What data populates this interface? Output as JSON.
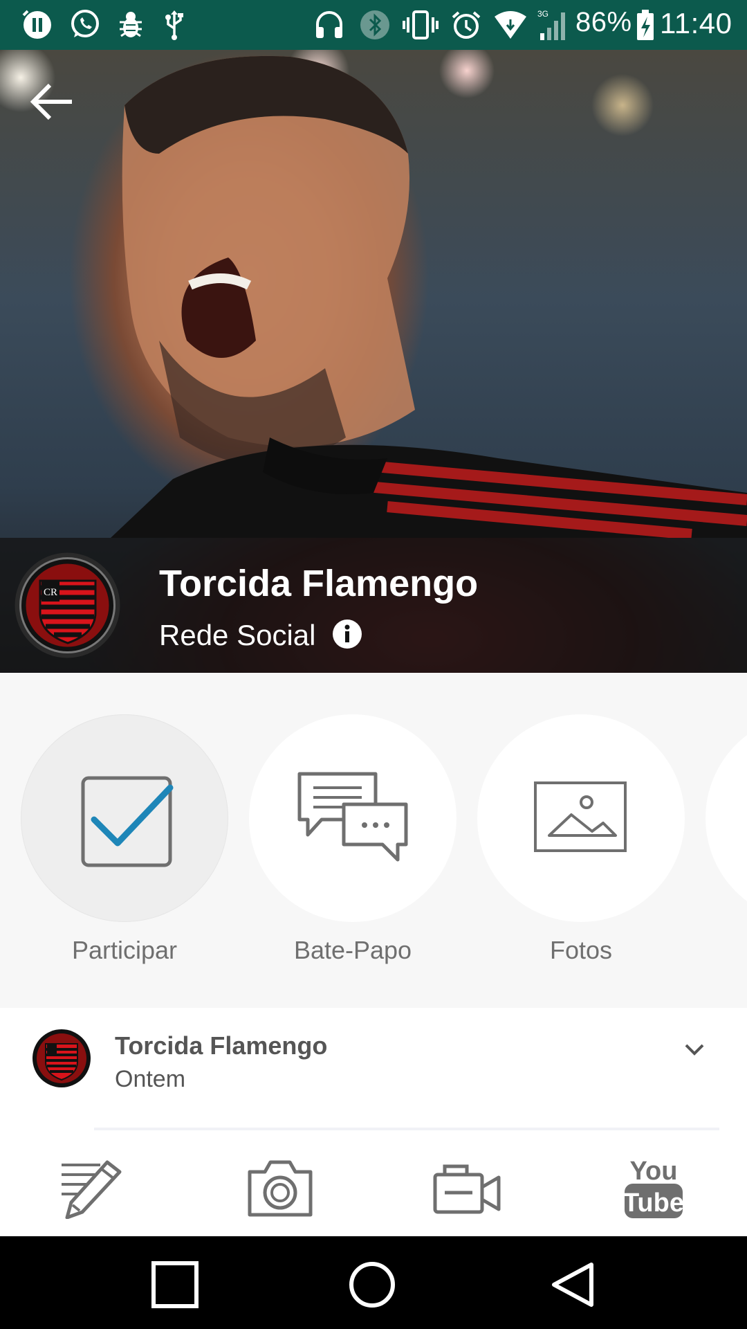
{
  "status_bar": {
    "battery_percent": "86%",
    "time": "11:40",
    "network_type": "3G",
    "icons": [
      "pause-icon",
      "whatsapp-icon",
      "bug-icon",
      "usb-icon",
      "headset-icon",
      "bluetooth-icon",
      "vibrate-icon",
      "alarm-icon",
      "wifi-icon",
      "signal-icon",
      "battery-charging-icon"
    ]
  },
  "header": {
    "title": "Torcida Flamengo",
    "subtitle": "Rede Social",
    "back_icon": "arrow-left-icon",
    "info_icon": "info-icon"
  },
  "actions": [
    {
      "label": "Participar",
      "icon": "checkbox-checked-icon",
      "active": true
    },
    {
      "label": "Bate-Papo",
      "icon": "chat-bubbles-icon",
      "active": false
    },
    {
      "label": "Fotos",
      "icon": "image-icon",
      "active": false
    }
  ],
  "post": {
    "author": "Torcida Flamengo",
    "time": "Ontem",
    "menu_icon": "chevron-down-icon"
  },
  "toolbar": {
    "items": [
      "write-post-icon",
      "camera-icon",
      "video-camera-icon",
      "youtube-icon"
    ],
    "youtube_top": "You",
    "youtube_bottom": "Tube"
  },
  "nav_bar": {
    "items": [
      "recents-square-icon",
      "home-circle-icon",
      "back-triangle-icon"
    ]
  },
  "colors": {
    "status_bar": "#0c5a4d",
    "check_accent": "#1e86b8",
    "icon_gray": "#6f6f6f"
  }
}
